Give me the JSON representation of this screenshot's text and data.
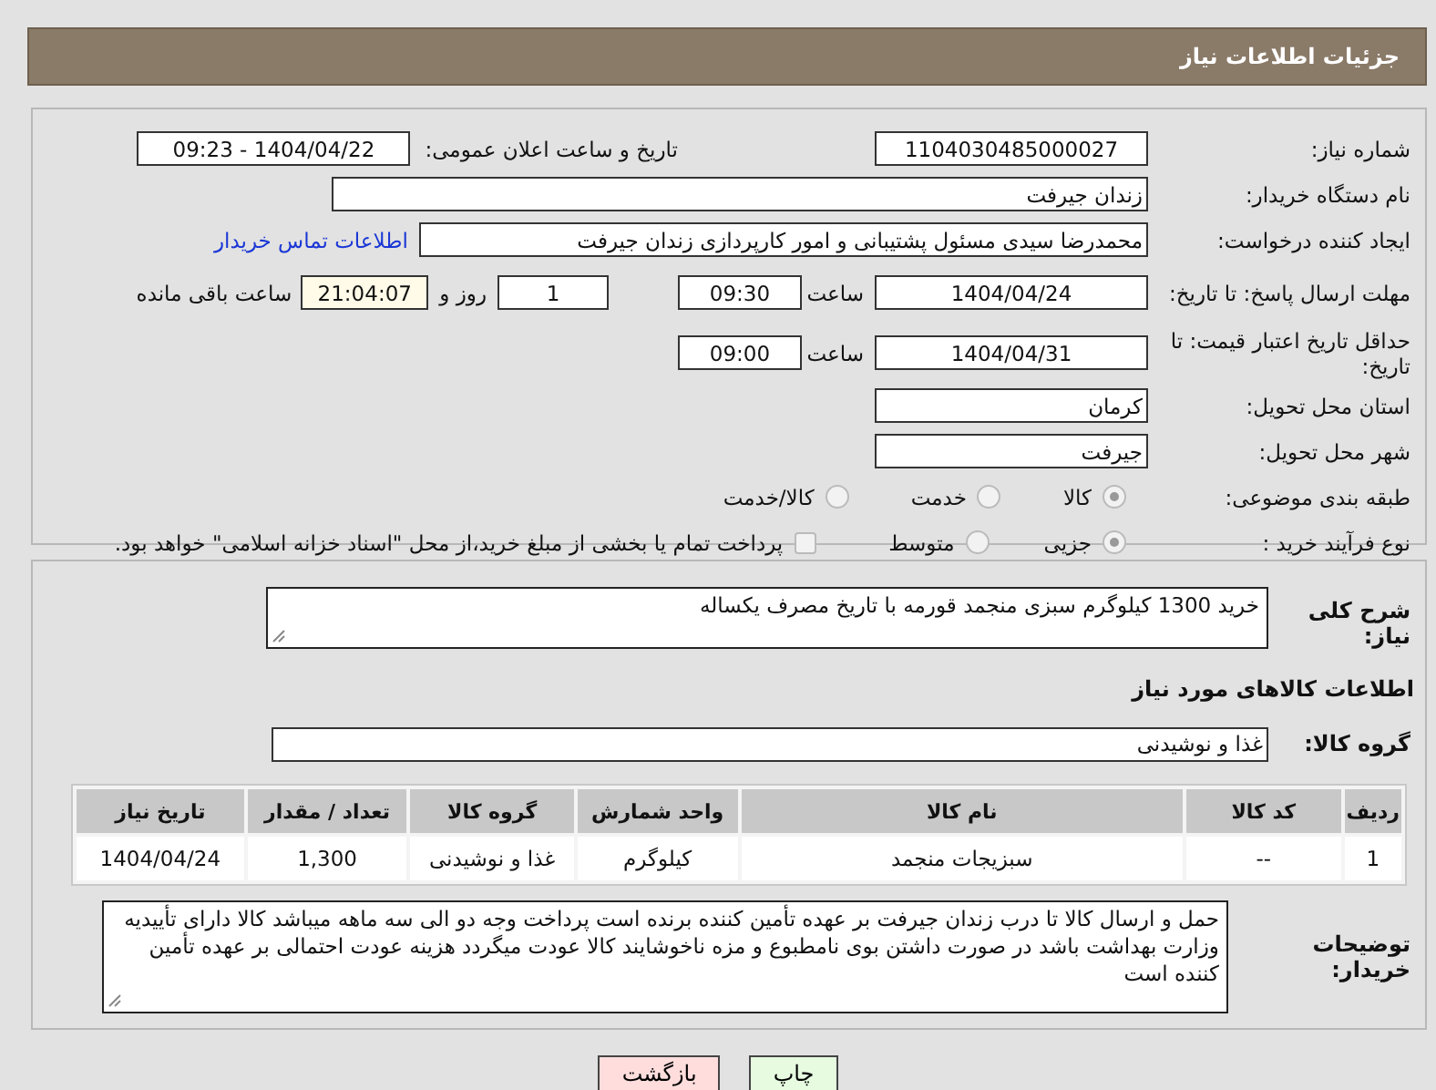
{
  "header": {
    "title": "جزئیات اطلاعات نیاز"
  },
  "need_number": {
    "label": "شماره نیاز:",
    "value": "1104030485000027"
  },
  "announce": {
    "label": "تاریخ و ساعت اعلان عمومی:",
    "value": "1404/04/22 - 09:23"
  },
  "buyer": {
    "label": "نام دستگاه خریدار:",
    "value": "زندان جیرفت"
  },
  "creator": {
    "label": "ایجاد کننده درخواست:",
    "value": "محمدرضا سیدی مسئول پشتیبانی و امور کارپردازی زندان جیرفت",
    "link": "اطلاعات تماس خریدار"
  },
  "deadline": {
    "label": "مهلت ارسال پاسخ: تا تاریخ:",
    "date": "1404/04/24",
    "time_label": "ساعت",
    "time": "09:30",
    "days": "1",
    "days_label": "روز و",
    "remaining": "21:04:07",
    "remaining_label": "ساعت باقی مانده"
  },
  "validity": {
    "label": "حداقل تاریخ اعتبار قیمت: تا تاریخ:",
    "date": "1404/04/31",
    "time_label": "ساعت",
    "time": "09:00"
  },
  "province": {
    "label": "استان محل تحویل:",
    "value": "کرمان"
  },
  "city": {
    "label": "شهر محل تحویل:",
    "value": "جیرفت"
  },
  "category": {
    "label": "طبقه بندی موضوعی:",
    "options": [
      {
        "label": "کالا",
        "selected": true
      },
      {
        "label": "خدمت",
        "selected": false
      },
      {
        "label": "کالا/خدمت",
        "selected": false
      }
    ]
  },
  "process": {
    "label": "نوع فرآیند خرید :",
    "options": [
      {
        "label": "جزیی",
        "selected": true
      },
      {
        "label": "متوسط",
        "selected": false
      }
    ],
    "payment": {
      "label": "پرداخت تمام یا بخشی از مبلغ خرید،از محل \"اسناد خزانه اسلامی\" خواهد بود.",
      "checked": false
    }
  },
  "description": {
    "label": "شرح کلی نیاز:",
    "value": "خرید 1300 کیلوگرم سبزی منجمد قورمه با تاریخ مصرف یکساله"
  },
  "goods": {
    "heading": "اطلاعات کالاهای مورد نیاز",
    "group_label": "گروه کالا:",
    "group": "غذا و نوشیدنی",
    "table": {
      "columns": [
        "ردیف",
        "کد کالا",
        "نام کالا",
        "واحد شمارش",
        "گروه کالا",
        "تعداد / مقدار",
        "تاریخ نیاز"
      ],
      "rows": [
        [
          "1",
          "--",
          "سبزیجات منجمد",
          "کیلوگرم",
          "غذا و نوشیدنی",
          "1,300",
          "1404/04/24"
        ]
      ]
    }
  },
  "buyer_notes": {
    "label": "توضیحات خریدار:",
    "value": "حمل و ارسال کالا تا درب زندان جیرفت بر عهده تأمین کننده برنده است پرداخت وجه دو الی سه ماهه میباشد کالا دارای تأییدیه وزارت بهداشت باشد در صورت داشتن بوی نامطبوع و مزه ناخوشایند کالا عودت میگردد هزینه عودت احتمالی بر عهده تأمین کننده است"
  },
  "buttons": [
    {
      "label": "چاپ",
      "kind": "print"
    },
    {
      "label": "بازگشت",
      "kind": "back"
    }
  ]
}
